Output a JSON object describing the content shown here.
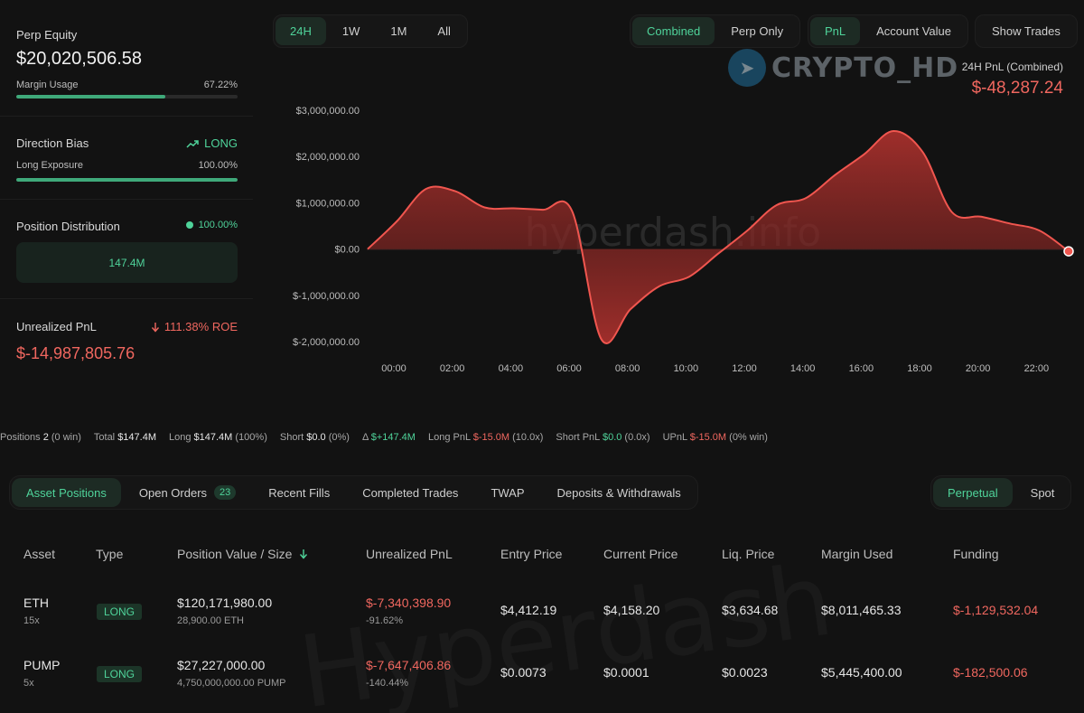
{
  "summary": {
    "perp_equity_label": "Perp Equity",
    "perp_equity_value": "$20,020,506.58",
    "margin_usage_label": "Margin Usage",
    "margin_usage_value": "67.22%",
    "margin_usage_fraction": 0.6722,
    "direction_bias_label": "Direction Bias",
    "direction_bias_value": "LONG",
    "long_exposure_label": "Long Exposure",
    "long_exposure_value": "100.00%",
    "long_exposure_fraction": 1.0,
    "position_distribution_label": "Position Distribution",
    "position_distribution_value": "100.00%",
    "position_distribution_amount": "147.4M",
    "unrealized_pnl_label": "Unrealized PnL",
    "unrealized_roe": "111.38% ROE",
    "unrealized_pnl_value": "$-14,987,805.76"
  },
  "controls": {
    "ranges": [
      "24H",
      "1W",
      "1M",
      "All"
    ],
    "active_range": "24H",
    "modes": [
      "Combined",
      "Perp Only"
    ],
    "active_mode": "Combined",
    "metrics": [
      "PnL",
      "Account Value"
    ],
    "active_metric": "PnL",
    "show_trades": "Show Trades"
  },
  "watermarks": {
    "tag": "CRYPTO_HD",
    "site": "hyperdash.info",
    "table_mark": "Hyperdash"
  },
  "pnl_header": {
    "label": "24H PnL (Combined)",
    "value": "$-48,287.24"
  },
  "chart_data": {
    "type": "area",
    "title": "",
    "xlabel": "",
    "ylabel": "",
    "ylim": [
      -2000000,
      3000000
    ],
    "yticks": [
      3000000,
      2000000,
      1000000,
      0,
      -1000000,
      -2000000
    ],
    "ytick_labels": [
      "$3,000,000.00",
      "$2,000,000.00",
      "$1,000,000.00",
      "$0.00",
      "$-1,000,000.00",
      "$-2,000,000.00"
    ],
    "xtick_labels": [
      "00:00",
      "02:00",
      "04:00",
      "06:00",
      "08:00",
      "10:00",
      "12:00",
      "14:00",
      "16:00",
      "18:00",
      "20:00",
      "22:00"
    ],
    "grid": false,
    "line_color": "#f0564f",
    "series": [
      {
        "x": [
          0.0,
          1.0,
          2.0,
          3.0,
          4.0,
          5.0,
          6.0,
          7.0,
          8.0,
          9.0,
          10.0,
          11.0,
          12.0,
          13.0,
          14.0,
          15.0,
          16.0,
          17.0,
          18.0,
          19.0,
          20.0,
          21.0,
          22.0,
          23.0,
          24.0
        ],
        "values": [
          0,
          600000,
          1300000,
          1250000,
          900000,
          880000,
          850000,
          820000,
          -1950000,
          -1300000,
          -800000,
          -600000,
          -100000,
          400000,
          950000,
          1100000,
          1600000,
          2050000,
          2550000,
          2100000,
          800000,
          700000,
          550000,
          400000,
          -48287
        ]
      }
    ]
  },
  "stats": [
    {
      "k": "Positions",
      "v": "2",
      "extra": "(0 win)"
    },
    {
      "k": "Total",
      "v": "$147.4M",
      "extra": ""
    },
    {
      "k": "Long",
      "v": "$147.4M",
      "extra": "(100%)"
    },
    {
      "k": "Short",
      "v": "$0.0",
      "extra": "(0%)"
    },
    {
      "k": "Δ",
      "v": "$+147.4M",
      "extra": ""
    },
    {
      "k": "Long PnL",
      "v": "$-15.0M",
      "extra": "(10.0x)"
    },
    {
      "k": "Short PnL",
      "v": "$0.0",
      "extra": "(0.0x)"
    },
    {
      "k": "UPnL",
      "v": "$-15.0M",
      "extra": "(0% win)"
    }
  ],
  "tabs": {
    "asset_positions": "Asset Positions",
    "open_orders": "Open Orders",
    "open_orders_count": "23",
    "recent_fills": "Recent Fills",
    "completed_trades": "Completed Trades",
    "twap": "TWAP",
    "deposits": "Deposits & Withdrawals",
    "perpetual": "Perpetual",
    "spot": "Spot"
  },
  "table": {
    "headers": {
      "asset": "Asset",
      "type": "Type",
      "value": "Position Value / Size",
      "upnl": "Unrealized PnL",
      "entry": "Entry Price",
      "current": "Current Price",
      "liq": "Liq. Price",
      "margin": "Margin Used",
      "funding": "Funding"
    },
    "rows": [
      {
        "asset": "ETH",
        "leverage": "15x",
        "type": "LONG",
        "value": "$120,171,980.00",
        "size": "28,900.00 ETH",
        "upnl": "$-7,340,398.90",
        "upnl_pct": "-91.62%",
        "entry": "$4,412.19",
        "current": "$4,158.20",
        "liq": "$3,634.68",
        "margin": "$8,011,465.33",
        "funding": "$-1,129,532.04"
      },
      {
        "asset": "PUMP",
        "leverage": "5x",
        "type": "LONG",
        "value": "$27,227,000.00",
        "size": "4,750,000,000.00 PUMP",
        "upnl": "$-7,647,406.86",
        "upnl_pct": "-140.44%",
        "entry": "$0.0073",
        "current": "$0.0001",
        "liq": "$0.0023",
        "margin": "$5,445,400.00",
        "funding": "$-182,500.06"
      }
    ]
  }
}
